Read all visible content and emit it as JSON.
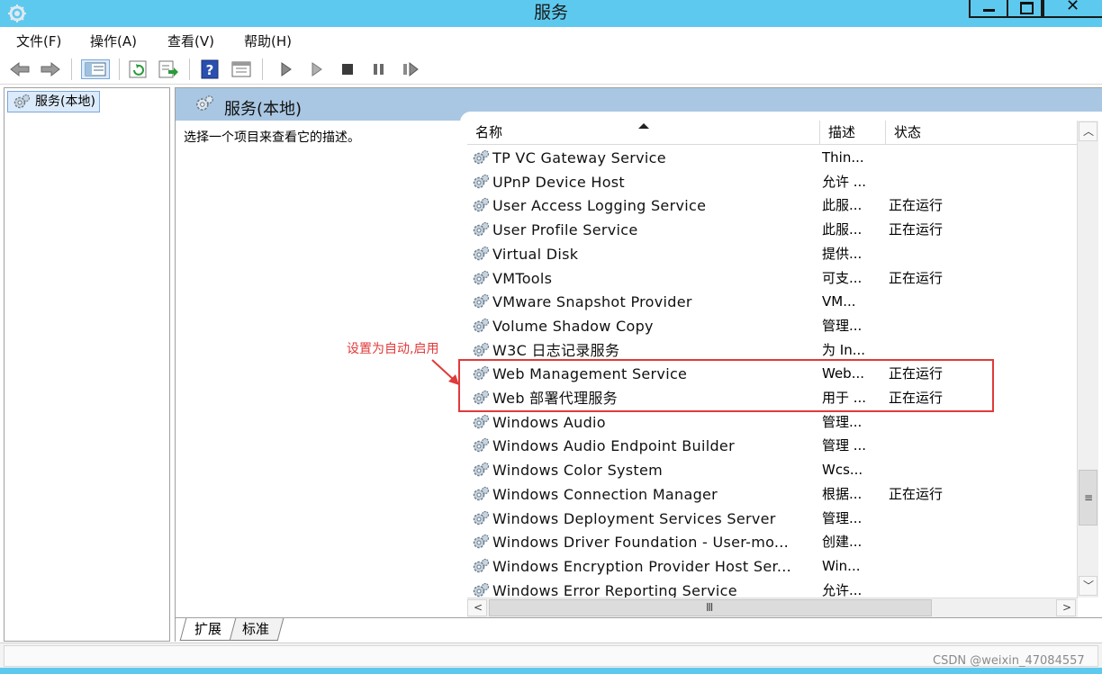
{
  "window": {
    "title": "服务"
  },
  "menu": {
    "items": [
      "文件(F)",
      "操作(A)",
      "查看(V)",
      "帮助(H)"
    ]
  },
  "toolbar": {
    "icons": [
      "back-arrow-icon",
      "forward-arrow-icon",
      "console-tree-icon",
      "refresh-icon",
      "export-list-icon",
      "help-icon",
      "properties-icon",
      "start-service-icon",
      "start-service-alt-icon",
      "stop-service-icon",
      "pause-service-icon",
      "resume-service-icon"
    ]
  },
  "tree": {
    "root_label": "服务(本地)"
  },
  "pane": {
    "title": "服务(本地)",
    "description_prompt": "选择一个项目来查看它的描述。"
  },
  "list": {
    "columns": [
      "名称",
      "描述",
      "状态"
    ],
    "rows": [
      {
        "name": "TP VC Gateway Service",
        "desc": "Thin...",
        "state": ""
      },
      {
        "name": "UPnP Device Host",
        "desc": "允许 ...",
        "state": ""
      },
      {
        "name": "User Access Logging Service",
        "desc": "此服...",
        "state": "正在运行"
      },
      {
        "name": "User Profile Service",
        "desc": "此服...",
        "state": "正在运行"
      },
      {
        "name": "Virtual Disk",
        "desc": "提供...",
        "state": ""
      },
      {
        "name": "VMTools",
        "desc": "可支...",
        "state": "正在运行"
      },
      {
        "name": "VMware Snapshot Provider",
        "desc": "VM...",
        "state": ""
      },
      {
        "name": "Volume Shadow Copy",
        "desc": "管理...",
        "state": ""
      },
      {
        "name": "W3C 日志记录服务",
        "desc": "为 In...",
        "state": ""
      },
      {
        "name": "Web Management Service",
        "desc": "Web...",
        "state": "正在运行"
      },
      {
        "name": "Web 部署代理服务",
        "desc": "用于 ...",
        "state": "正在运行"
      },
      {
        "name": "Windows Audio",
        "desc": "管理...",
        "state": ""
      },
      {
        "name": "Windows Audio Endpoint Builder",
        "desc": "管理 ...",
        "state": ""
      },
      {
        "name": "Windows Color System",
        "desc": "Wcs...",
        "state": ""
      },
      {
        "name": "Windows Connection Manager",
        "desc": "根据...",
        "state": "正在运行"
      },
      {
        "name": "Windows Deployment Services Server",
        "desc": "管理...",
        "state": ""
      },
      {
        "name": "Windows Driver Foundation - User-mo...",
        "desc": "创建...",
        "state": ""
      },
      {
        "name": "Windows Encryption Provider Host Ser...",
        "desc": "Win...",
        "state": ""
      },
      {
        "name": "Windows Error Reporting Service",
        "desc": "允许...",
        "state": ""
      }
    ]
  },
  "tabs": [
    "扩展",
    "标准"
  ],
  "annotation": {
    "text": "设置为自动,启用",
    "color": "#e03a3a"
  },
  "watermark": "CSDN @weixin_47084557",
  "colors": {
    "titlebar": "#5ec9ee",
    "pane_header": "#a9c7e3",
    "selection": "#dcebfb"
  }
}
